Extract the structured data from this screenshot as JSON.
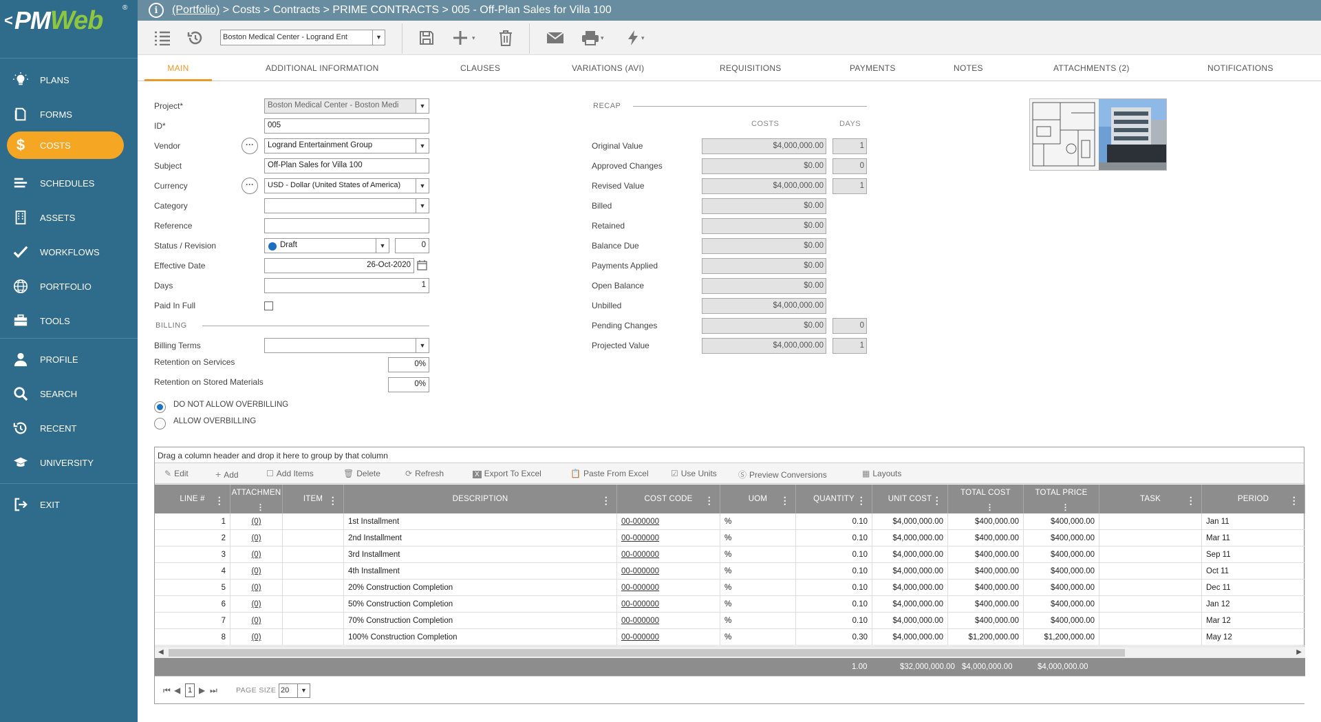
{
  "app": {
    "logo_pm": "PM",
    "logo_web": "Web",
    "back": "<",
    "registered": "®"
  },
  "sidebar": {
    "items": [
      {
        "label": "PLANS",
        "icon": "bulb-icon"
      },
      {
        "label": "FORMS",
        "icon": "document-icon"
      },
      {
        "label": "COSTS",
        "icon": "dollar-icon",
        "active": true
      },
      {
        "label": "SCHEDULES",
        "icon": "bars-icon"
      },
      {
        "label": "ASSETS",
        "icon": "building-icon"
      },
      {
        "label": "WORKFLOWS",
        "icon": "check-icon"
      },
      {
        "label": "PORTFOLIO",
        "icon": "globe-icon"
      },
      {
        "label": "TOOLS",
        "icon": "toolbox-icon"
      },
      {
        "label": "PROFILE",
        "icon": "person-icon"
      },
      {
        "label": "SEARCH",
        "icon": "search-icon"
      },
      {
        "label": "RECENT",
        "icon": "history-icon"
      },
      {
        "label": "UNIVERSITY",
        "icon": "graduation-cap-icon"
      },
      {
        "label": "EXIT",
        "icon": "exit-icon"
      }
    ]
  },
  "breadcrumb": {
    "info": "i",
    "portfolio": "(Portfolio)",
    "rest": " > Costs > Contracts > PRIME CONTRACTS > 005 - Off-Plan Sales for Villa 100"
  },
  "toolbar": {
    "project_select": "Boston Medical Center - Logrand Ent"
  },
  "tabs": [
    "MAIN",
    "ADDITIONAL INFORMATION",
    "CLAUSES",
    "VARIATIONS (AVI)",
    "REQUISITIONS",
    "PAYMENTS",
    "NOTES",
    "ATTACHMENTS (2)",
    "NOTIFICATIONS"
  ],
  "form": {
    "project_label": "Project*",
    "project_value": "Boston Medical Center - Boston Medi",
    "id_label": "ID*",
    "id_value": "005",
    "vendor_label": "Vendor",
    "vendor_value": "Logrand Entertainment Group",
    "subject_label": "Subject",
    "subject_value": "Off-Plan Sales for Villa 100",
    "currency_label": "Currency",
    "currency_value": "USD - Dollar (United States of America)",
    "category_label": "Category",
    "category_value": "",
    "reference_label": "Reference",
    "reference_value": "",
    "status_label": "Status / Revision",
    "status_value": "Draft",
    "revision_value": "0",
    "effective_label": "Effective Date",
    "effective_value": "26-Oct-2020",
    "days_label": "Days",
    "days_value": "1",
    "paid_label": "Paid In Full",
    "billing_header": "BILLING",
    "billing_terms_label": "Billing Terms",
    "billing_terms_value": "",
    "ret_services_label": "Retention on Services",
    "ret_services_value": "0%",
    "ret_materials_label": "Retention on Stored Materials",
    "ret_materials_value": "0%",
    "opt_no_overbilling": "DO NOT ALLOW OVERBILLING",
    "opt_overbilling": "ALLOW OVERBILLING"
  },
  "recap": {
    "header": "RECAP",
    "costs_header": "COSTS",
    "days_header": "DAYS",
    "rows": [
      {
        "label": "Original Value",
        "cost": "$4,000,000.00",
        "days": "1"
      },
      {
        "label": "Approved Changes",
        "cost": "$0.00",
        "days": "0"
      },
      {
        "label": "Revised Value",
        "cost": "$4,000,000.00",
        "days": "1"
      },
      {
        "label": "Billed",
        "cost": "$0.00",
        "days": null
      },
      {
        "label": "Retained",
        "cost": "$0.00",
        "days": null
      },
      {
        "label": "Balance Due",
        "cost": "$0.00",
        "days": null
      },
      {
        "label": "Payments Applied",
        "cost": "$0.00",
        "days": null
      },
      {
        "label": "Open Balance",
        "cost": "$0.00",
        "days": null
      },
      {
        "label": "Unbilled",
        "cost": "$4,000,000.00",
        "days": null
      },
      {
        "label": "Pending Changes",
        "cost": "$0.00",
        "days": "0"
      },
      {
        "label": "Projected Value",
        "cost": "$4,000,000.00",
        "days": "1"
      }
    ]
  },
  "grid": {
    "drag_text": "Drag a column header and drop it here to group by that column",
    "toolbar": [
      "Edit",
      "Add",
      "Add Items",
      "Delete",
      "Refresh",
      "Export To Excel",
      "Paste From Excel",
      "Use Units",
      "Preview Conversions",
      "Layouts"
    ],
    "columns": [
      "LINE #",
      "ATTACHMEN",
      "ITEM",
      "DESCRIPTION",
      "COST CODE",
      "UOM",
      "QUANTITY",
      "UNIT COST",
      "TOTAL COST",
      "TOTAL PRICE",
      "TASK",
      "PERIOD"
    ],
    "rows": [
      {
        "line": "1",
        "att": "(0)",
        "item": "",
        "desc": "1st Installment",
        "code": "00-000000",
        "uom": "%",
        "qty": "0.10",
        "unit": "$4,000,000.00",
        "total": "$400,000.00",
        "price": "$400,000.00",
        "task": "",
        "period": "Jan 11"
      },
      {
        "line": "2",
        "att": "(0)",
        "item": "",
        "desc": "2nd Installment",
        "code": "00-000000",
        "uom": "%",
        "qty": "0.10",
        "unit": "$4,000,000.00",
        "total": "$400,000.00",
        "price": "$400,000.00",
        "task": "",
        "period": "Mar 11"
      },
      {
        "line": "3",
        "att": "(0)",
        "item": "",
        "desc": "3rd Installment",
        "code": "00-000000",
        "uom": "%",
        "qty": "0.10",
        "unit": "$4,000,000.00",
        "total": "$400,000.00",
        "price": "$400,000.00",
        "task": "",
        "period": "Sep 11"
      },
      {
        "line": "4",
        "att": "(0)",
        "item": "",
        "desc": "4th Installment",
        "code": "00-000000",
        "uom": "%",
        "qty": "0.10",
        "unit": "$4,000,000.00",
        "total": "$400,000.00",
        "price": "$400,000.00",
        "task": "",
        "period": "Oct 11"
      },
      {
        "line": "5",
        "att": "(0)",
        "item": "",
        "desc": "20% Construction Completion",
        "code": "00-000000",
        "uom": "%",
        "qty": "0.10",
        "unit": "$4,000,000.00",
        "total": "$400,000.00",
        "price": "$400,000.00",
        "task": "",
        "period": "Dec 11"
      },
      {
        "line": "6",
        "att": "(0)",
        "item": "",
        "desc": "50% Construction Completion",
        "code": "00-000000",
        "uom": "%",
        "qty": "0.10",
        "unit": "$4,000,000.00",
        "total": "$400,000.00",
        "price": "$400,000.00",
        "task": "",
        "period": "Jan 12"
      },
      {
        "line": "7",
        "att": "(0)",
        "item": "",
        "desc": "70% Construction Completion",
        "code": "00-000000",
        "uom": "%",
        "qty": "0.10",
        "unit": "$4,000,000.00",
        "total": "$400,000.00",
        "price": "$400,000.00",
        "task": "",
        "period": "Mar 12"
      },
      {
        "line": "8",
        "att": "(0)",
        "item": "",
        "desc": "100% Construction Completion",
        "code": "00-000000",
        "uom": "%",
        "qty": "0.30",
        "unit": "$4,000,000.00",
        "total": "$1,200,000.00",
        "price": "$1,200,000.00",
        "task": "",
        "period": "May 12"
      }
    ],
    "totals": {
      "qty": "1.00",
      "unit": "$32,000,000.00",
      "total": "$4,000,000.00",
      "price": "$4,000,000.00"
    },
    "pager": {
      "page": "1",
      "page_size_label": "PAGE SIZE",
      "page_size": "20"
    }
  },
  "colors": {
    "sidebar": "#2f6b8a",
    "topbar": "#688da0",
    "accent": "#f5a623",
    "grid_header": "#8d8d8d"
  }
}
